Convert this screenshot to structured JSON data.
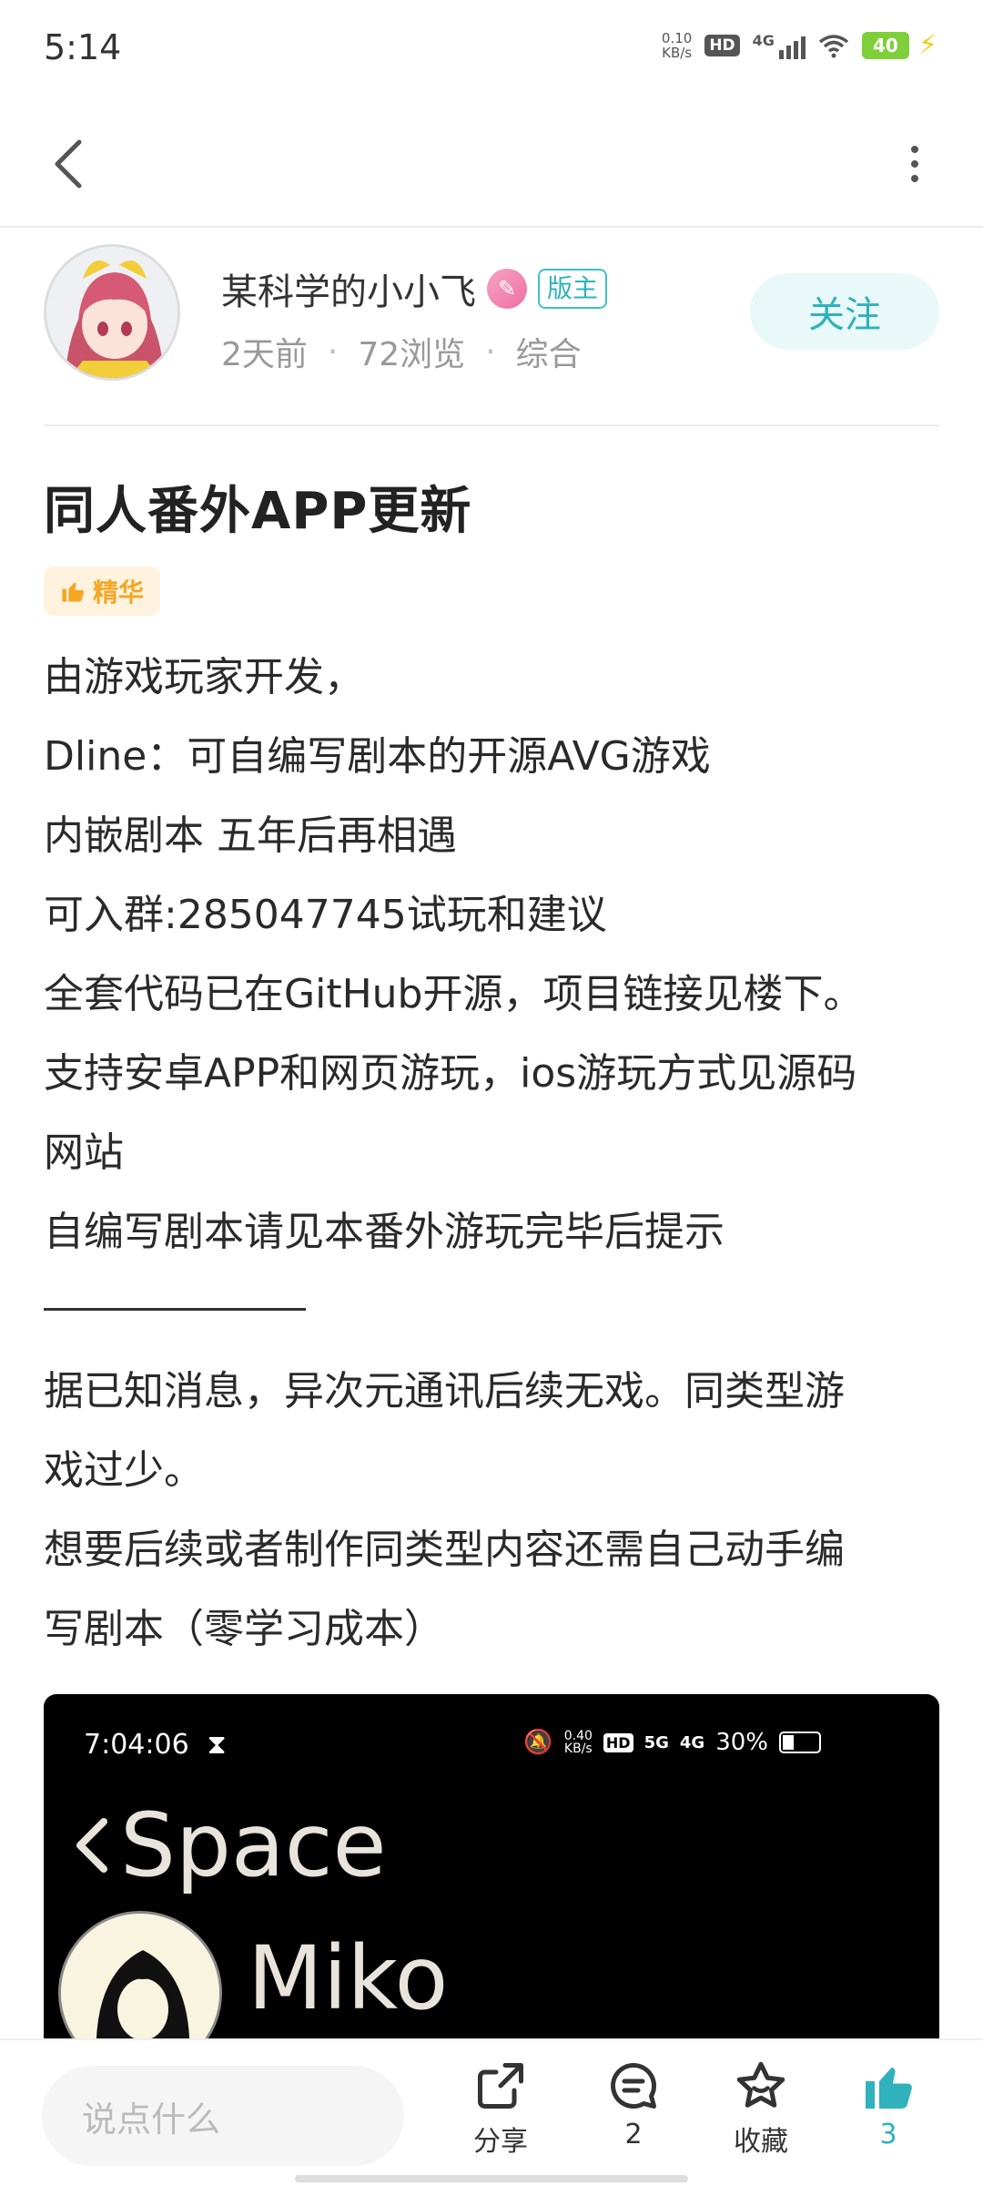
{
  "status_bar": {
    "time": "5:14",
    "net_speed_value": "0.10",
    "net_speed_unit": "KB/s",
    "hd": "HD",
    "network": "4G",
    "battery": "40"
  },
  "author": {
    "name": "某科学的小小飞",
    "role": "版主",
    "time_ago": "2天前",
    "views": "72浏览",
    "category": "综合",
    "follow_label": "关注"
  },
  "post": {
    "title": "同人番外APP更新",
    "featured_label": "精华",
    "lines": [
      "由游戏玩家开发，",
      "Dline：可自编写剧本的开源AVG游戏",
      "内嵌剧本 五年后再相遇",
      "可入群:285047745试玩和建议",
      "全套代码已在GitHub开源，项目链接见楼下。",
      "支持安卓APP和网页游玩，ios游玩方式见源码",
      "网站",
      "自编写剧本请见本番外游玩完毕后提示"
    ],
    "lines2": [
      "据已知消息，异次元通讯后续无戏。同类型游",
      "戏过少。",
      "想要后续或者制作同类型内容还需自己动手编",
      "写剧本（零学习成本）"
    ]
  },
  "embedded_screenshot": {
    "time": "7:04:06",
    "net_speed_value": "0.40",
    "net_speed_unit": "KB/s",
    "network_5g": "5G",
    "network_4g": "4G",
    "battery": "30%",
    "back_title": "Space",
    "contact_name": "Miko"
  },
  "bottom_bar": {
    "comment_placeholder": "说点什么",
    "share_label": "分享",
    "comment_count": "2",
    "favorite_label": "收藏",
    "like_count": "3"
  },
  "colors": {
    "accent": "#2fb2bb",
    "featured": "#f5a623",
    "battery": "#7fcf3a"
  }
}
